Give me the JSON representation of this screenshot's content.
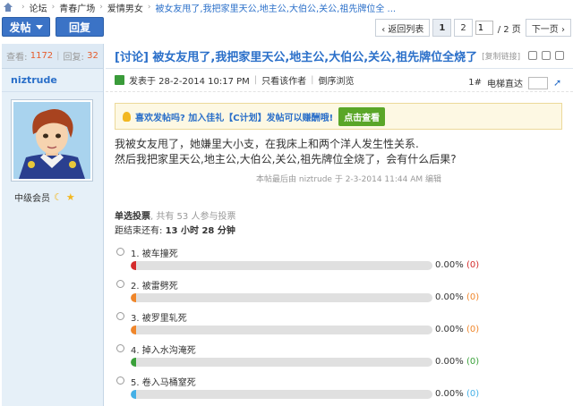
{
  "breadcrumb": {
    "items": [
      "论坛",
      "青春广场",
      "爱情男女"
    ],
    "current": "被女友甩了,我把家里天公,地主公,大伯公,关公,祖先牌位全 ..."
  },
  "toolbar": {
    "post_label": "发帖",
    "reply_label": "回复"
  },
  "pager": {
    "back_label": "‹ 返回列表",
    "pages": [
      "1",
      "2"
    ],
    "page_input_value": "1",
    "total_label": "/ 2 页",
    "next_label": "下一页 ›"
  },
  "side": {
    "views_label": "查看:",
    "views": "1172",
    "sep": "|",
    "replies_label": "回复:",
    "replies": "32",
    "author": "niztrude",
    "rank": "中级会员"
  },
  "post": {
    "title": "[讨论] 被女友甩了,我把家里天公,地主公,大伯公,关公,祖先牌位全烧了",
    "copy_label": "[复制链接]",
    "posted_label": "发表于 28-2-2014 10:17 PM",
    "only_author": "只看该作者",
    "reverse": "倒序浏览",
    "floor": "1#",
    "jump_label": "电梯直达",
    "notice_text": "喜欢发帖吗? 加入佳礼【C计划】发帖可以赚酬哦!",
    "notice_btn": "点击查看",
    "body_line1": "我被女友甩了，她嫌里大小支，在我床上和两个洋人发生性关系.",
    "body_line2": "然后我把家里天公,地主公,大伯公,关公,祖先牌位全烧了，会有什么后果?",
    "edit_note": "本帖最后由 niztrude 于 2-3-2014 11:44 AM 编辑"
  },
  "poll": {
    "type_label": "单选投票",
    "voters_text": ", 共有 53 人参与投票",
    "timer_label": "距结束还有:",
    "timer_value": "13 小时 28 分钟",
    "options": [
      {
        "label": "1.  被车撞死",
        "pct": "0.00%",
        "count": "(0)",
        "color": "#d42b2b",
        "fill": 0.0
      },
      {
        "label": "2.  被雷劈死",
        "pct": "0.00%",
        "count": "(0)",
        "color": "#f0862a",
        "fill": 0.0
      },
      {
        "label": "3.  被罗里轧死",
        "pct": "0.00%",
        "count": "(0)",
        "color": "#f0862a",
        "fill": 0.0
      },
      {
        "label": "4.  掉入水沟淹死",
        "pct": "0.00%",
        "count": "(0)",
        "color": "#3aa13a",
        "fill": 0.0
      },
      {
        "label": "5.  卷入马桶窒死",
        "pct": "0.00%",
        "count": "(0)",
        "color": "#45b0e6",
        "fill": 0.0
      }
    ]
  }
}
